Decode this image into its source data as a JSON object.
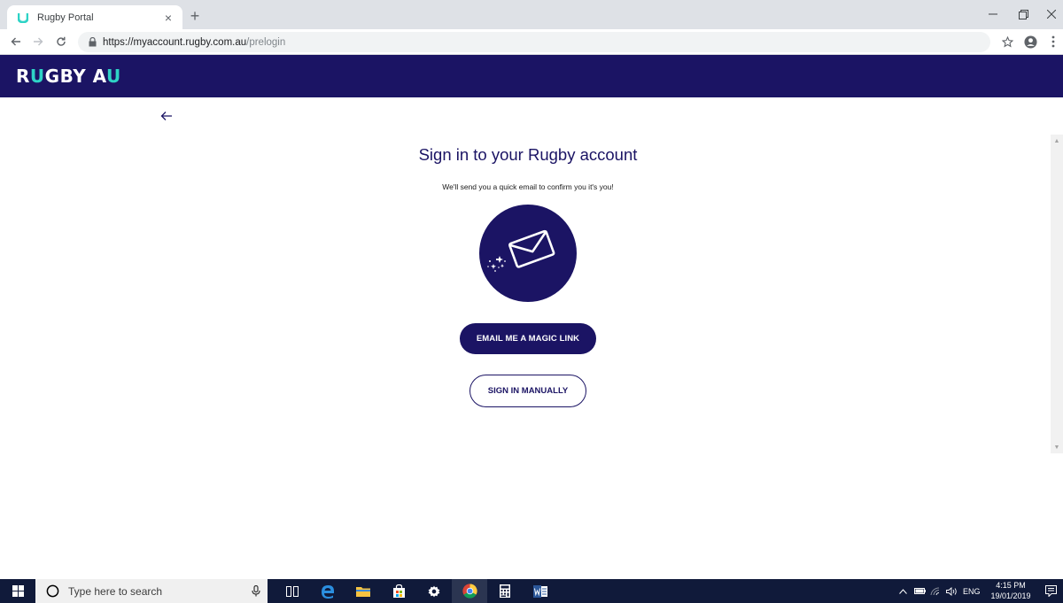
{
  "browser": {
    "tab_title": "Rugby Portal",
    "url_host": "https://myaccount.rugby.com.au",
    "url_path": "/prelogin"
  },
  "site": {
    "logo_pre": "R",
    "logo_u1": "U",
    "logo_mid": "GBY A",
    "logo_u2": "U"
  },
  "signin": {
    "title": "Sign in to your Rugby account",
    "subtitle": "We'll send you a quick email to confirm you it's you!",
    "magic_link_button": "EMAIL ME A MAGIC LINK",
    "manual_button": "SIGN IN MANUALLY"
  },
  "taskbar": {
    "search_placeholder": "Type here to search",
    "language": "ENG",
    "time": "4:15 PM",
    "date": "19/01/2019"
  },
  "colors": {
    "brand_navy": "#1b1464",
    "brand_teal": "#2ed3c6"
  }
}
